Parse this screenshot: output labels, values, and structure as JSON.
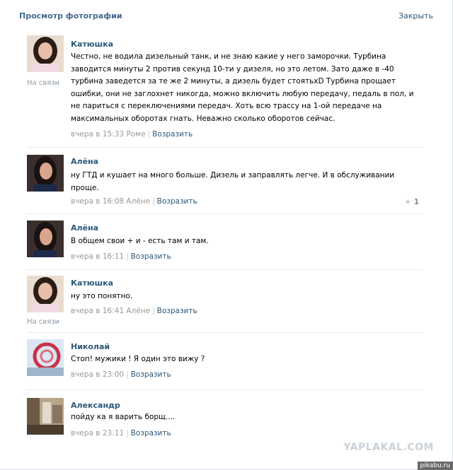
{
  "header": {
    "title": "Просмотр фотографии",
    "close_label": "Закрыть"
  },
  "comments": [
    {
      "author": "Катюшка",
      "status": "На связи",
      "text": "Честно, не водила дизельный танк, и не знаю какие у него заморочки. Турбина заводится минуты 2 против секунд 10-ти у дизеля, но это летом. Зато даже в -40 турбина заведется за те же 2 минуты, а дизель будет стоятьxD Турбина прощает ошибки, они не заглохнет никогда, можно включить любую передачу, педаль в пол, и не париться с переключениями передач. Хоть всю трассу на 1-ой передаче на максимальных оборотах гнать. Неважно сколько оборотов сейчас.",
      "time": "вчера в 15:33",
      "to": "Роме",
      "reply": "Возразить"
    },
    {
      "author": "Алёна",
      "text": "ну ГТД и кушает на много больше. Дизель и заправлять легче. И в обслуживании проще.",
      "time": "вчера в 16:08",
      "to": "Алёне",
      "reply": "Возразить",
      "likes": "1"
    },
    {
      "author": "Алёна",
      "text": "В общем свои + и - есть там и там.",
      "time": "вчера в 16:11",
      "reply": "Возразить"
    },
    {
      "author": "Катюшка",
      "status": "На связи",
      "text": "ну это понятно.",
      "time": "вчера в 16:41",
      "to": "Алёне",
      "reply": "Возразить"
    },
    {
      "author": "Николай",
      "text": "Стоп! мужики ! Я один это вижу ?",
      "time": "вчера в 23:00",
      "reply": "Возразить"
    },
    {
      "author": "Александр",
      "text": "пойду ка я варить борщ....",
      "time": "вчера в 23:11",
      "reply": "Возразить"
    }
  ],
  "watermarks": {
    "main": "YAPLAKAL.COM",
    "corner": "pikabu.ru"
  },
  "icons": {
    "likes": "star-icon"
  },
  "colors": {
    "link": "#2b587a",
    "title": "#45688e",
    "muted": "#999999"
  }
}
